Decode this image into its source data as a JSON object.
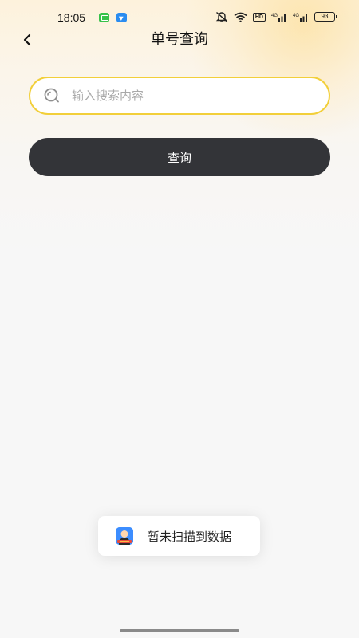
{
  "status_bar": {
    "time": "18:05",
    "hd_label": "HD",
    "signal_label_1": "4G",
    "signal_label_2": "4G",
    "battery": "93"
  },
  "header": {
    "title": "单号查询",
    "back_icon": "chevron-left-icon"
  },
  "search": {
    "placeholder": "输入搜索内容",
    "value": "",
    "icon": "search-icon"
  },
  "query_button_label": "查询",
  "toast": {
    "message": "暂未扫描到数据",
    "icon": "app-logo-icon"
  },
  "colors": {
    "accent_border": "#f2cf3a",
    "button_bg": "#333438",
    "button_text": "#ffffff"
  }
}
